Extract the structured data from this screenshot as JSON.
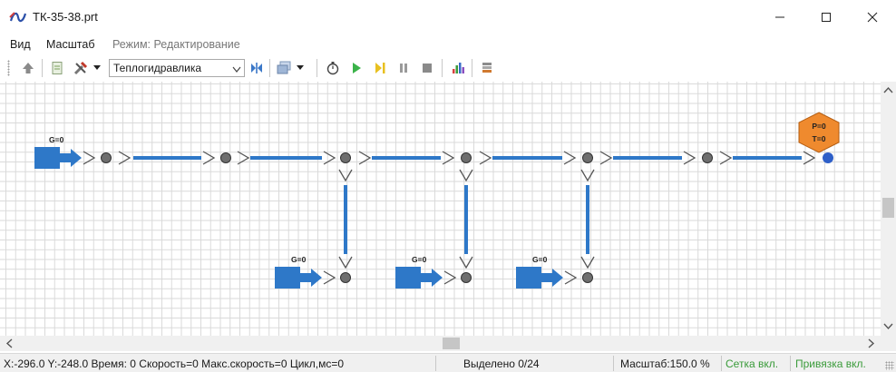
{
  "window": {
    "title": "ТК-35-38.prt"
  },
  "menu": {
    "view": "Вид",
    "scale": "Масштаб",
    "mode": "Режим: Редактирование"
  },
  "toolbar": {
    "domain_select": "Теплогидравлика",
    "icons": [
      "up-arrow-icon",
      "document-icon",
      "tools-icon",
      "swap-icon",
      "layers-icon",
      "stopwatch-icon",
      "play-icon",
      "step-icon",
      "pause-icon",
      "stop-icon",
      "chart-icon",
      "database-icon"
    ]
  },
  "diagram": {
    "sources": [
      {
        "label": "G=0"
      },
      {
        "label": "G=0"
      },
      {
        "label": "G=0"
      },
      {
        "label": "G=0"
      }
    ],
    "sink": {
      "label_p": "P=0",
      "label_t": "T=0"
    },
    "colors": {
      "pipe": "#2e78c8",
      "node": "#6e6e6e",
      "sink": "#ef8a2e",
      "source": "#2e78c8"
    }
  },
  "status": {
    "coords": "X:-296.0  Y:-248.0 Время: 0 Скорость=0 Макс.скорость=0 Цикл,мс=0",
    "selected": "Выделено 0/24",
    "scale": "Масштаб:150.0 %",
    "grid": "Сетка вкл.",
    "snap": "Привязка вкл."
  }
}
